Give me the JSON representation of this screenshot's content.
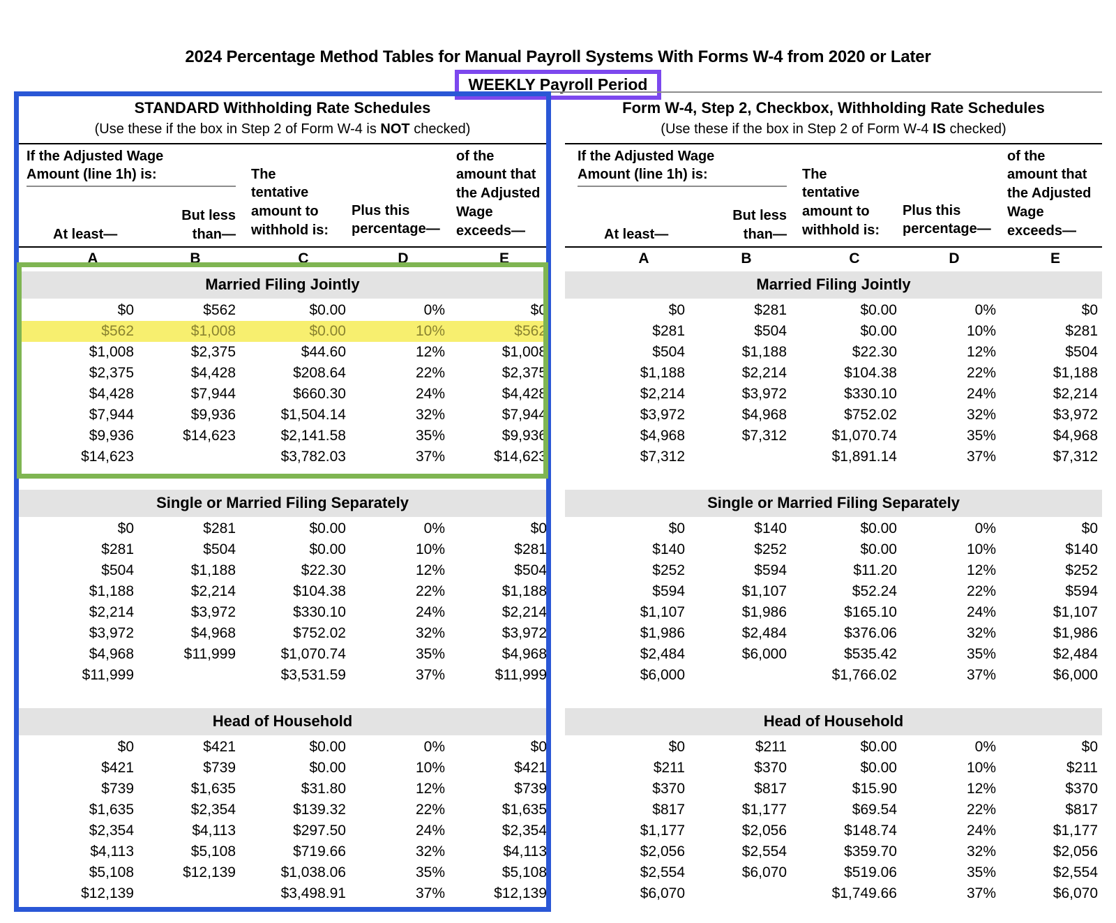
{
  "title": "2024 Percentage Method Tables for Manual Payroll Systems With Forms W-4 from 2020 or Later",
  "payroll_period": "WEEKLY Payroll Period",
  "column_letters": [
    "A",
    "B",
    "C",
    "D",
    "E"
  ],
  "headers": {
    "wage_line_1": "If the Adjusted Wage",
    "wage_line_2": "Amount (line 1h) is:",
    "at_least": "At least—",
    "but_less_than_1": "But less",
    "but_less_than_2": "than—",
    "tentative_1": "The",
    "tentative_2": "tentative",
    "tentative_3": "amount to",
    "tentative_4": "withhold is:",
    "plus_pct_1": "Plus this",
    "plus_pct_2": "percentage—",
    "exceeds_1": "of the",
    "exceeds_2": "amount that",
    "exceeds_3": "the Adjusted",
    "exceeds_4": "Wage",
    "exceeds_5": "exceeds—"
  },
  "annotation_colors": {
    "blue_box": "#2a57d6",
    "green_box": "#7fb552",
    "purple_box": "#7c48ee",
    "yellow_highlight": "#f7ef6f",
    "highlight_text": "#8a8330",
    "section_band": "#e3e3e3"
  },
  "left_table": {
    "heading": "STANDARD Withholding Rate Schedules",
    "subheading_pre": "(Use these if the box in Step 2 of Form W-4 is ",
    "subheading_bold": "NOT",
    "subheading_post": " checked)",
    "sections": [
      {
        "name": "Married Filing Jointly",
        "rows": [
          {
            "a": "$0",
            "b": "$562",
            "c": "$0.00",
            "d": "0%",
            "e": "$0",
            "highlight": false
          },
          {
            "a": "$562",
            "b": "$1,008",
            "c": "$0.00",
            "d": "10%",
            "e": "$562",
            "highlight": true
          },
          {
            "a": "$1,008",
            "b": "$2,375",
            "c": "$44.60",
            "d": "12%",
            "e": "$1,008",
            "highlight": false
          },
          {
            "a": "$2,375",
            "b": "$4,428",
            "c": "$208.64",
            "d": "22%",
            "e": "$2,375",
            "highlight": false
          },
          {
            "a": "$4,428",
            "b": "$7,944",
            "c": "$660.30",
            "d": "24%",
            "e": "$4,428",
            "highlight": false
          },
          {
            "a": "$7,944",
            "b": "$9,936",
            "c": "$1,504.14",
            "d": "32%",
            "e": "$7,944",
            "highlight": false
          },
          {
            "a": "$9,936",
            "b": "$14,623",
            "c": "$2,141.58",
            "d": "35%",
            "e": "$9,936",
            "highlight": false
          },
          {
            "a": "$14,623",
            "b": "",
            "c": "$3,782.03",
            "d": "37%",
            "e": "$14,623",
            "highlight": false
          }
        ]
      },
      {
        "name": "Single or Married Filing Separately",
        "rows": [
          {
            "a": "$0",
            "b": "$281",
            "c": "$0.00",
            "d": "0%",
            "e": "$0",
            "highlight": false
          },
          {
            "a": "$281",
            "b": "$504",
            "c": "$0.00",
            "d": "10%",
            "e": "$281",
            "highlight": false
          },
          {
            "a": "$504",
            "b": "$1,188",
            "c": "$22.30",
            "d": "12%",
            "e": "$504",
            "highlight": false
          },
          {
            "a": "$1,188",
            "b": "$2,214",
            "c": "$104.38",
            "d": "22%",
            "e": "$1,188",
            "highlight": false
          },
          {
            "a": "$2,214",
            "b": "$3,972",
            "c": "$330.10",
            "d": "24%",
            "e": "$2,214",
            "highlight": false
          },
          {
            "a": "$3,972",
            "b": "$4,968",
            "c": "$752.02",
            "d": "32%",
            "e": "$3,972",
            "highlight": false
          },
          {
            "a": "$4,968",
            "b": "$11,999",
            "c": "$1,070.74",
            "d": "35%",
            "e": "$4,968",
            "highlight": false
          },
          {
            "a": "$11,999",
            "b": "",
            "c": "$3,531.59",
            "d": "37%",
            "e": "$11,999",
            "highlight": false
          }
        ]
      },
      {
        "name": "Head of Household",
        "rows": [
          {
            "a": "$0",
            "b": "$421",
            "c": "$0.00",
            "d": "0%",
            "e": "$0",
            "highlight": false
          },
          {
            "a": "$421",
            "b": "$739",
            "c": "$0.00",
            "d": "10%",
            "e": "$421",
            "highlight": false
          },
          {
            "a": "$739",
            "b": "$1,635",
            "c": "$31.80",
            "d": "12%",
            "e": "$739",
            "highlight": false
          },
          {
            "a": "$1,635",
            "b": "$2,354",
            "c": "$139.32",
            "d": "22%",
            "e": "$1,635",
            "highlight": false
          },
          {
            "a": "$2,354",
            "b": "$4,113",
            "c": "$297.50",
            "d": "24%",
            "e": "$2,354",
            "highlight": false
          },
          {
            "a": "$4,113",
            "b": "$5,108",
            "c": "$719.66",
            "d": "32%",
            "e": "$4,113",
            "highlight": false
          },
          {
            "a": "$5,108",
            "b": "$12,139",
            "c": "$1,038.06",
            "d": "35%",
            "e": "$5,108",
            "highlight": false
          },
          {
            "a": "$12,139",
            "b": "",
            "c": "$3,498.91",
            "d": "37%",
            "e": "$12,139",
            "highlight": false
          }
        ]
      }
    ]
  },
  "right_table": {
    "heading": "Form W-4, Step 2, Checkbox, Withholding Rate Schedules",
    "subheading_pre": "(Use these if the box in Step 2 of Form W-4 ",
    "subheading_bold": "IS",
    "subheading_post": " checked)",
    "sections": [
      {
        "name": "Married Filing Jointly",
        "rows": [
          {
            "a": "$0",
            "b": "$281",
            "c": "$0.00",
            "d": "0%",
            "e": "$0",
            "highlight": false
          },
          {
            "a": "$281",
            "b": "$504",
            "c": "$0.00",
            "d": "10%",
            "e": "$281",
            "highlight": false
          },
          {
            "a": "$504",
            "b": "$1,188",
            "c": "$22.30",
            "d": "12%",
            "e": "$504",
            "highlight": false
          },
          {
            "a": "$1,188",
            "b": "$2,214",
            "c": "$104.38",
            "d": "22%",
            "e": "$1,188",
            "highlight": false
          },
          {
            "a": "$2,214",
            "b": "$3,972",
            "c": "$330.10",
            "d": "24%",
            "e": "$2,214",
            "highlight": false
          },
          {
            "a": "$3,972",
            "b": "$4,968",
            "c": "$752.02",
            "d": "32%",
            "e": "$3,972",
            "highlight": false
          },
          {
            "a": "$4,968",
            "b": "$7,312",
            "c": "$1,070.74",
            "d": "35%",
            "e": "$4,968",
            "highlight": false
          },
          {
            "a": "$7,312",
            "b": "",
            "c": "$1,891.14",
            "d": "37%",
            "e": "$7,312",
            "highlight": false
          }
        ]
      },
      {
        "name": "Single or Married Filing Separately",
        "rows": [
          {
            "a": "$0",
            "b": "$140",
            "c": "$0.00",
            "d": "0%",
            "e": "$0",
            "highlight": false
          },
          {
            "a": "$140",
            "b": "$252",
            "c": "$0.00",
            "d": "10%",
            "e": "$140",
            "highlight": false
          },
          {
            "a": "$252",
            "b": "$594",
            "c": "$11.20",
            "d": "12%",
            "e": "$252",
            "highlight": false
          },
          {
            "a": "$594",
            "b": "$1,107",
            "c": "$52.24",
            "d": "22%",
            "e": "$594",
            "highlight": false
          },
          {
            "a": "$1,107",
            "b": "$1,986",
            "c": "$165.10",
            "d": "24%",
            "e": "$1,107",
            "highlight": false
          },
          {
            "a": "$1,986",
            "b": "$2,484",
            "c": "$376.06",
            "d": "32%",
            "e": "$1,986",
            "highlight": false
          },
          {
            "a": "$2,484",
            "b": "$6,000",
            "c": "$535.42",
            "d": "35%",
            "e": "$2,484",
            "highlight": false
          },
          {
            "a": "$6,000",
            "b": "",
            "c": "$1,766.02",
            "d": "37%",
            "e": "$6,000",
            "highlight": false
          }
        ]
      },
      {
        "name": "Head of Household",
        "rows": [
          {
            "a": "$0",
            "b": "$211",
            "c": "$0.00",
            "d": "0%",
            "e": "$0",
            "highlight": false
          },
          {
            "a": "$211",
            "b": "$370",
            "c": "$0.00",
            "d": "10%",
            "e": "$211",
            "highlight": false
          },
          {
            "a": "$370",
            "b": "$817",
            "c": "$15.90",
            "d": "12%",
            "e": "$370",
            "highlight": false
          },
          {
            "a": "$817",
            "b": "$1,177",
            "c": "$69.54",
            "d": "22%",
            "e": "$817",
            "highlight": false
          },
          {
            "a": "$1,177",
            "b": "$2,056",
            "c": "$148.74",
            "d": "24%",
            "e": "$1,177",
            "highlight": false
          },
          {
            "a": "$2,056",
            "b": "$2,554",
            "c": "$359.70",
            "d": "32%",
            "e": "$2,056",
            "highlight": false
          },
          {
            "a": "$2,554",
            "b": "$6,070",
            "c": "$519.06",
            "d": "35%",
            "e": "$2,554",
            "highlight": false
          },
          {
            "a": "$6,070",
            "b": "",
            "c": "$1,749.66",
            "d": "37%",
            "e": "$6,070",
            "highlight": false
          }
        ]
      }
    ]
  }
}
